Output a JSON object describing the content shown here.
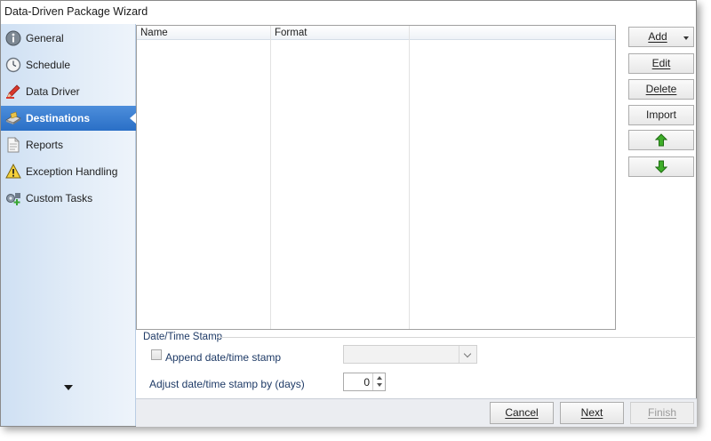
{
  "window": {
    "title": "Data-Driven Package Wizard"
  },
  "sidebar": {
    "items": [
      {
        "label": "General",
        "icon": "info-icon"
      },
      {
        "label": "Schedule",
        "icon": "clock-icon"
      },
      {
        "label": "Data Driver",
        "icon": "pencil-icon"
      },
      {
        "label": "Destinations",
        "icon": "destination-icon",
        "active": true
      },
      {
        "label": "Reports",
        "icon": "document-icon"
      },
      {
        "label": "Exception Handling",
        "icon": "warning-icon"
      },
      {
        "label": "Custom Tasks",
        "icon": "tasks-icon"
      }
    ],
    "scroll_icon": "scroll-down-arrow-icon"
  },
  "destinations_list": {
    "columns": [
      "Name",
      "Format",
      ""
    ],
    "rows": []
  },
  "actions": {
    "add": "Add",
    "edit": "Edit",
    "delete": "Delete",
    "import": "Import",
    "move_up_icon": "arrow-up-icon",
    "move_down_icon": "arrow-down-icon"
  },
  "timestamp": {
    "group_label": "Date/Time Stamp",
    "append_label": "Append date/time stamp",
    "append_checked": false,
    "format_value": "",
    "adjust_label": "Adjust date/time stamp by (days)",
    "adjust_value": "0"
  },
  "footer": {
    "cancel": "Cancel",
    "next": "Next",
    "finish": "Finish"
  },
  "colors": {
    "active_nav": "#2a6fc6",
    "arrow_green": "#3fae2a"
  }
}
